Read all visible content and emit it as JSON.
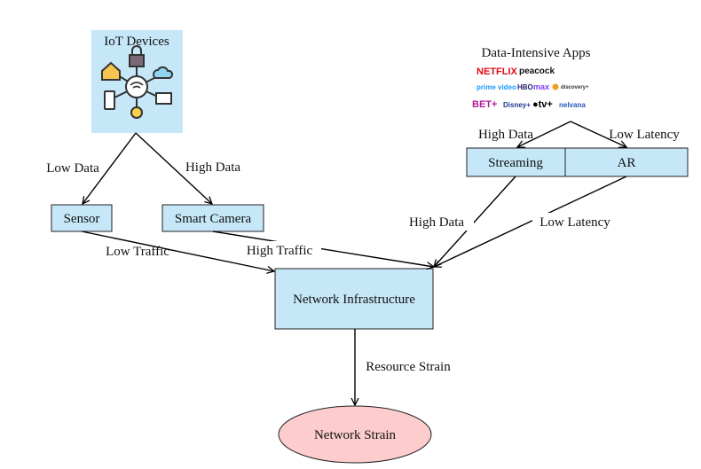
{
  "nodes": {
    "iot": "IoT Devices",
    "sensor": "Sensor",
    "camera": "Smart Camera",
    "apps": "Data-Intensive Apps",
    "streaming": "Streaming",
    "ar": "AR",
    "network": "Network Infrastructure",
    "strain": "Network Strain"
  },
  "app_logos": [
    "NETFLIX",
    "peacock",
    "prime video",
    "HBO max",
    "discovery+",
    "BET+",
    "Disney+",
    "tv+",
    "nelvana"
  ],
  "edges": {
    "iot_sensor": "Low Data",
    "iot_camera": "High Data",
    "sensor_network": "Low Traffic",
    "camera_network": "High Traffic",
    "apps_streaming": "High Data",
    "apps_ar": "Low Latency",
    "streaming_network": "High Data",
    "ar_network": "Low Latency",
    "network_strain": "Resource Strain"
  },
  "colors": {
    "box": "#c6e7f8",
    "strain": "#fdcccc"
  }
}
